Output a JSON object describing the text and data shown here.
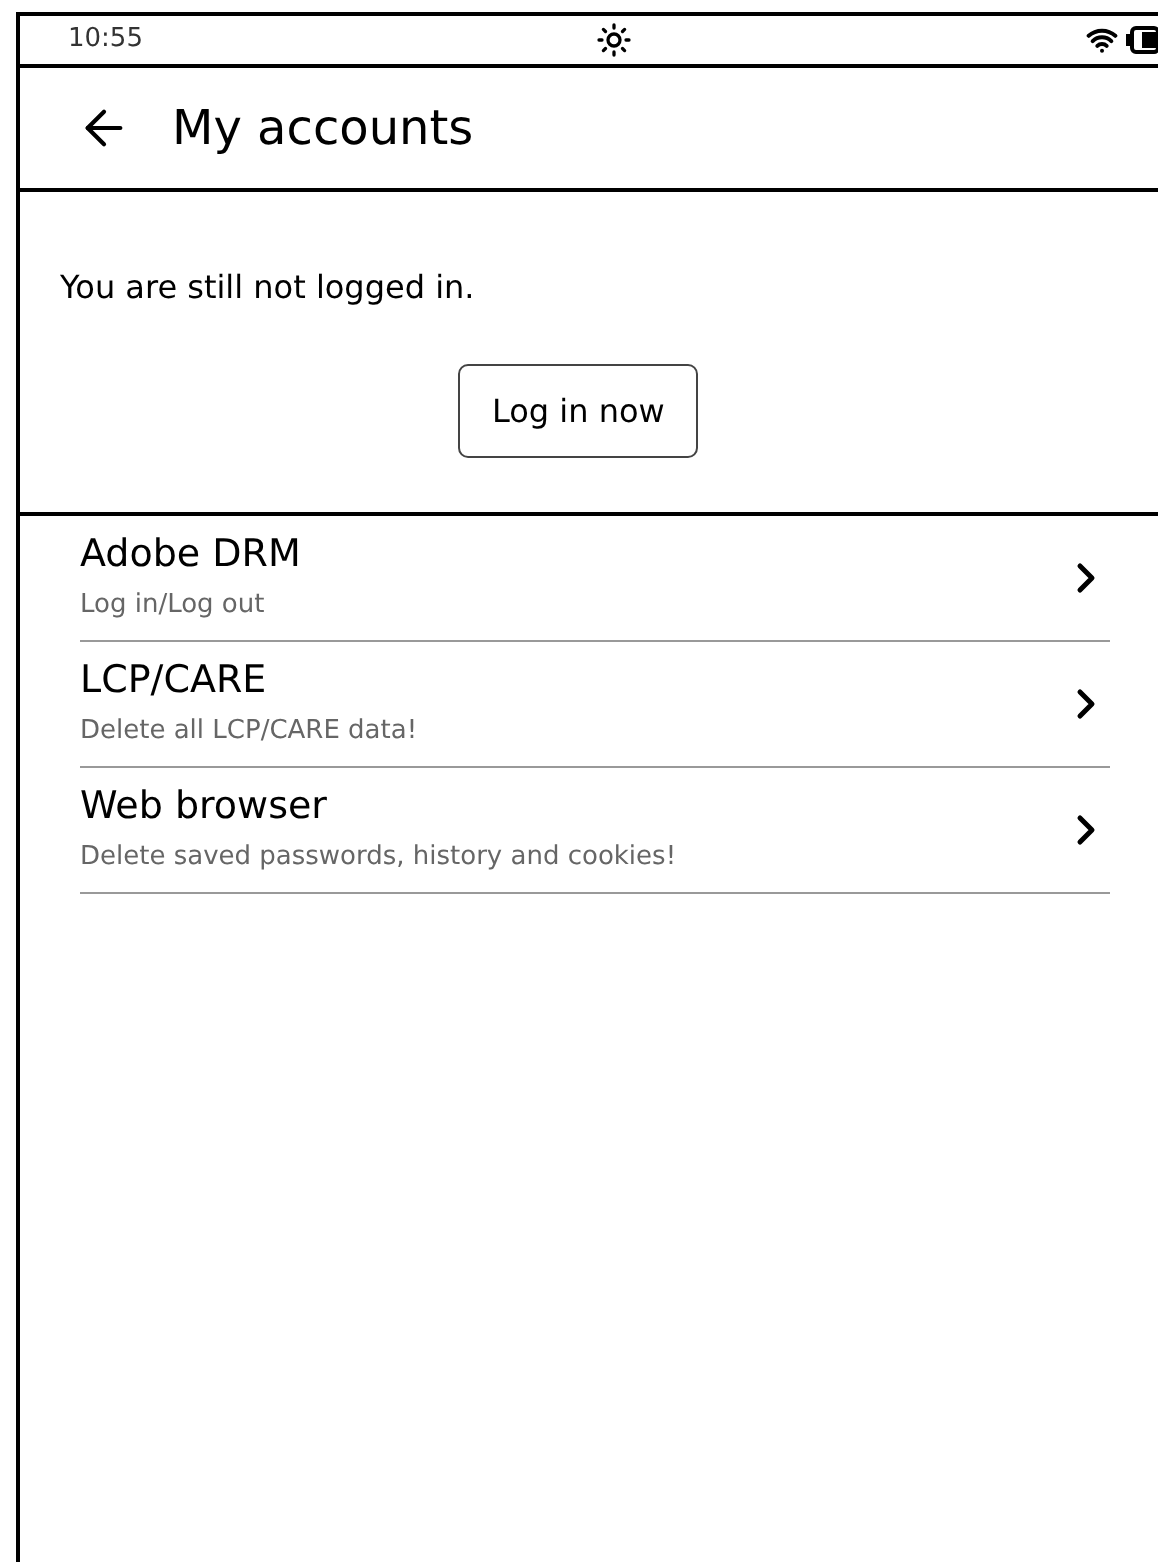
{
  "status_bar": {
    "time": "10:55"
  },
  "header": {
    "title": "My accounts"
  },
  "login": {
    "message": "You are still not logged in.",
    "button": "Log in now"
  },
  "accounts": [
    {
      "title": "Adobe DRM",
      "subtitle": "Log in/Log out"
    },
    {
      "title": "LCP/CARE",
      "subtitle": "Delete all LCP/CARE data!"
    },
    {
      "title": "Web browser",
      "subtitle": "Delete saved passwords, history and cookies!"
    }
  ]
}
